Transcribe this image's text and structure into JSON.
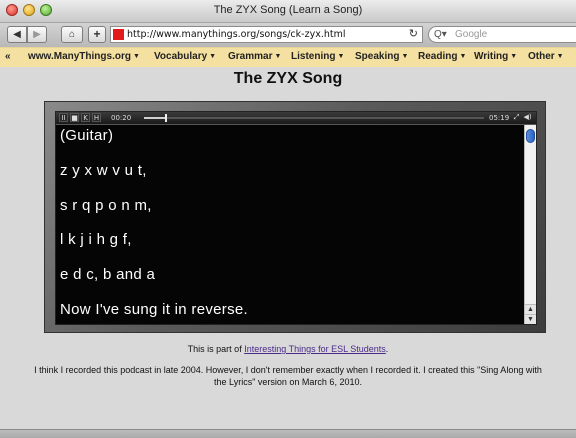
{
  "window": {
    "title": "The ZYX Song (Learn a Song)"
  },
  "toolbar": {
    "back_icon": "back-arrow-icon",
    "forward_icon": "forward-arrow-icon",
    "home_icon": "home-icon",
    "add_icon": "plus-icon",
    "url": "http://www.manythings.org/songs/ck-zyx.html",
    "search_placeholder": "Google"
  },
  "bookmarks": {
    "overflow": "«",
    "items": [
      {
        "label": "www.ManyThings.org"
      },
      {
        "label": "Vocabulary"
      },
      {
        "label": "Grammar"
      },
      {
        "label": "Listening"
      },
      {
        "label": "Speaking"
      },
      {
        "label": "Reading"
      },
      {
        "label": "Writing"
      },
      {
        "label": "Other"
      }
    ]
  },
  "page": {
    "title": "The ZYX Song",
    "player": {
      "elapsed": "00:20",
      "total": "05:19",
      "progress_fraction": 0.063,
      "lyrics": [
        "(Guitar)",
        "z y x w v u t,",
        "s r q p o n m,",
        "l k j i h g f,",
        "e d c, b and a",
        "Now I've sung it in reverse."
      ]
    },
    "info_prefix": "This is part of ",
    "info_link": "Interesting Things for ESL Students",
    "info_suffix": ".",
    "note": "I think I recorded this podcast in late 2004. However, I don't remember exactly when I recorded it. I created this \"Sing Along with the Lyrics\" version on March 6, 2010."
  },
  "colors": {
    "bookmarks_bg": "#f4e0a0",
    "link": "#4b2a8a",
    "scroll_thumb": "#2a63c4"
  }
}
